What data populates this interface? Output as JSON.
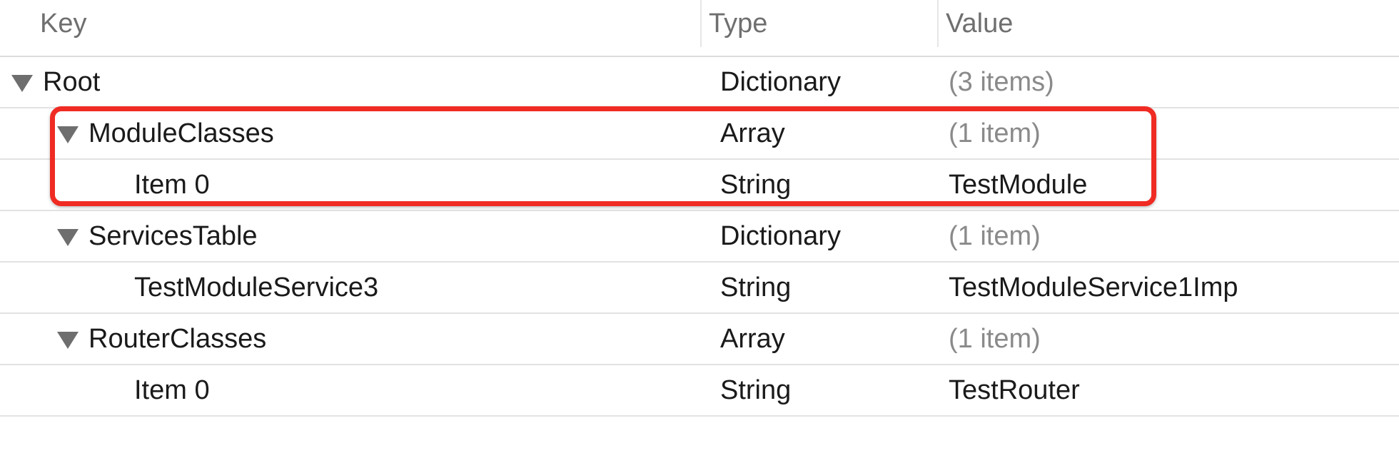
{
  "columns": {
    "key": "Key",
    "type": "Type",
    "value": "Value"
  },
  "rows": [
    {
      "key": "Root",
      "type": "Dictionary",
      "value": "(3 items)",
      "level": 0,
      "expandable": true,
      "value_muted": true
    },
    {
      "key": "ModuleClasses",
      "type": "Array",
      "value": "(1 item)",
      "level": 1,
      "expandable": true,
      "value_muted": true
    },
    {
      "key": "Item 0",
      "type": "String",
      "value": "TestModule",
      "level": 2,
      "expandable": false,
      "value_muted": false
    },
    {
      "key": "ServicesTable",
      "type": "Dictionary",
      "value": "(1 item)",
      "level": 1,
      "expandable": true,
      "value_muted": true
    },
    {
      "key": "TestModuleService3",
      "type": "String",
      "value": "TestModuleService1Imp",
      "level": 2,
      "expandable": false,
      "value_muted": false
    },
    {
      "key": "RouterClasses",
      "type": "Array",
      "value": "(1 item)",
      "level": 1,
      "expandable": true,
      "value_muted": true
    },
    {
      "key": "Item 0",
      "type": "String",
      "value": "TestRouter",
      "level": 2,
      "expandable": false,
      "value_muted": false
    }
  ],
  "colors": {
    "highlight": "#ef2b23",
    "header_text": "#6f6f6f",
    "muted_value": "#8a8a8a"
  }
}
